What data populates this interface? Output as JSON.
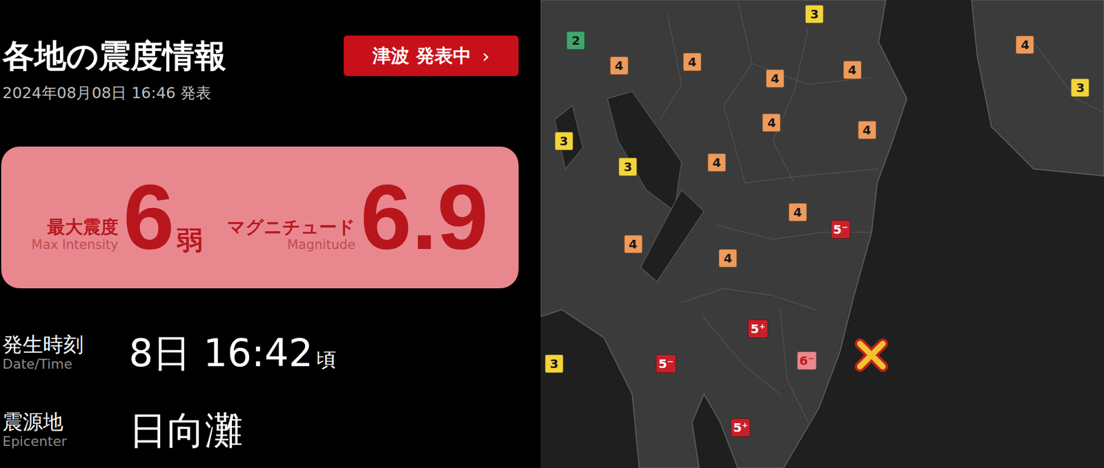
{
  "header": {
    "title": "各地の震度情報",
    "tsunami_button": "津波 発表中",
    "tsunami_chevron": "›",
    "issued": "2024年08月08日 16:46 発表"
  },
  "summary": {
    "intensity_label": "最大震度",
    "intensity_label_en": "Max Intensity",
    "intensity_value": "6",
    "intensity_suffix": "弱",
    "magnitude_label": "マグニチュード",
    "magnitude_label_en": "Magnitude",
    "magnitude_value": "6.9"
  },
  "details": [
    {
      "label": "発生時刻",
      "label_en": "Date/Time",
      "value": "8日 16:42",
      "suffix": "頃"
    },
    {
      "label": "震源地",
      "label_en": "Epicenter",
      "value": "日向灘",
      "suffix": ""
    }
  ],
  "map": {
    "markers": [
      {
        "intensity": "3",
        "color": "#f2d43c"
      },
      {
        "intensity": "2",
        "color": "#3fa86a"
      },
      {
        "intensity": "4",
        "color": "#ee9a5a"
      },
      {
        "intensity": "4",
        "color": "#ee9a5a"
      },
      {
        "intensity": "4",
        "color": "#ee9a5a"
      },
      {
        "intensity": "4",
        "color": "#ee9a5a"
      },
      {
        "intensity": "4",
        "color": "#ee9a5a"
      },
      {
        "intensity": "3",
        "color": "#f2d43c"
      },
      {
        "intensity": "3",
        "color": "#f2d43c"
      },
      {
        "intensity": "4",
        "color": "#ee9a5a"
      },
      {
        "intensity": "4",
        "color": "#ee9a5a"
      },
      {
        "intensity": "3",
        "color": "#f2d43c"
      },
      {
        "intensity": "4",
        "color": "#ee9a5a"
      },
      {
        "intensity": "4",
        "color": "#ee9a5a"
      },
      {
        "intensity": "5⁻",
        "color": "#c8202a"
      },
      {
        "intensity": "4",
        "color": "#ee9a5a"
      },
      {
        "intensity": "4",
        "color": "#ee9a5a"
      },
      {
        "intensity": "5⁺",
        "color": "#c8202a"
      },
      {
        "intensity": "6⁻",
        "color": "#e8898e"
      },
      {
        "intensity": "5⁻",
        "color": "#c8202a"
      },
      {
        "intensity": "3",
        "color": "#f2d43c"
      },
      {
        "intensity": "5⁺",
        "color": "#c8202a"
      }
    ]
  }
}
